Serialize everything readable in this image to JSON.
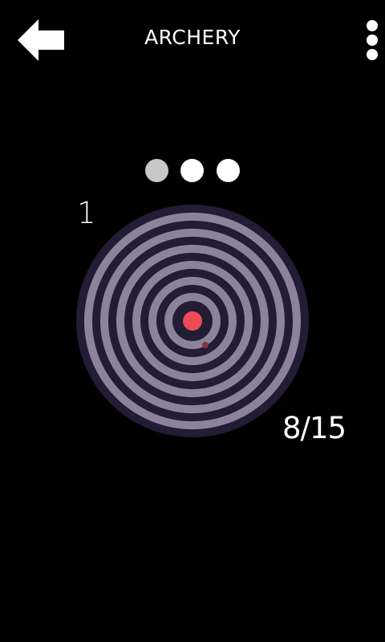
{
  "header": {
    "title": "ARCHERY",
    "back_icon": "arrow-left-icon",
    "menu_icon": "vertical-dots-icon"
  },
  "attempts": [
    {
      "state": "used",
      "color": "#c8c8c8"
    },
    {
      "state": "remaining",
      "color": "#ffffff"
    },
    {
      "state": "remaining",
      "color": "#ffffff"
    }
  ],
  "game": {
    "level": "1",
    "score": "8/15"
  },
  "target": {
    "rings": 10,
    "colors": {
      "outer_border": "#221c35",
      "light_ring": "#8d829c",
      "dark_ring": "#221c35",
      "bullseye": "#ee4a55",
      "arrow_hit": "#8a2f3c"
    }
  }
}
